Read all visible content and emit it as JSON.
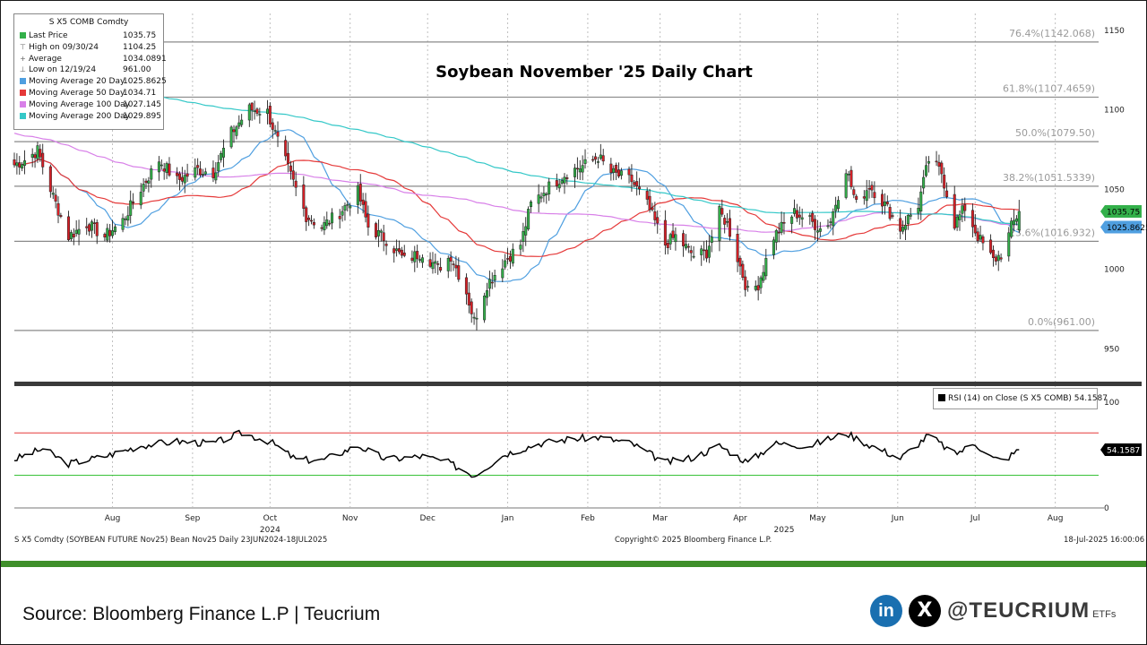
{
  "chart_data": {
    "type": "candlestick",
    "title": "Soybean November '25 Daily Chart",
    "ylim": [
      930,
      1160
    ],
    "yticks": [
      950,
      1000,
      1050,
      1100,
      1150
    ],
    "x_start": "2024-06-24",
    "x_end": "2025-08-15",
    "month_ticks": [
      {
        "label": "Aug",
        "date": "2024-08-01"
      },
      {
        "label": "Sep",
        "date": "2024-09-01"
      },
      {
        "label": "Oct",
        "date": "2024-10-01"
      },
      {
        "label": "Nov",
        "date": "2024-11-01"
      },
      {
        "label": "Dec",
        "date": "2024-12-01"
      },
      {
        "label": "Jan",
        "date": "2025-01-01"
      },
      {
        "label": "Feb",
        "date": "2025-02-01"
      },
      {
        "label": "Mar",
        "date": "2025-03-01"
      },
      {
        "label": "Apr",
        "date": "2025-04-01"
      },
      {
        "label": "May",
        "date": "2025-05-01"
      },
      {
        "label": "Jun",
        "date": "2025-06-01"
      },
      {
        "label": "Jul",
        "date": "2025-07-01"
      },
      {
        "label": "Aug",
        "date": "2025-08-01"
      }
    ],
    "year_labels": [
      {
        "label": "2024",
        "date": "2024-10-01"
      },
      {
        "label": "2025",
        "date": "2025-04-18"
      }
    ],
    "fib_levels": [
      {
        "label": "76.4%(1142.068)",
        "value": 1142.068
      },
      {
        "label": "61.8%(1107.4659)",
        "value": 1107.4659
      },
      {
        "label": "50.0%(1079.50)",
        "value": 1079.5
      },
      {
        "label": "38.2%(1051.5339)",
        "value": 1051.5339
      },
      {
        "label": "23.6%(1016.932)",
        "value": 1016.932
      },
      {
        "label": "0.0%(961.00)",
        "value": 961.0
      }
    ],
    "close_anchors": [
      [
        "2024-06-24",
        1065
      ],
      [
        "2024-06-28",
        1068
      ],
      [
        "2024-07-03",
        1074
      ],
      [
        "2024-07-09",
        1045
      ],
      [
        "2024-07-15",
        1020
      ],
      [
        "2024-07-22",
        1028
      ],
      [
        "2024-07-29",
        1020
      ],
      [
        "2024-08-05",
        1030
      ],
      [
        "2024-08-12",
        1050
      ],
      [
        "2024-08-19",
        1068
      ],
      [
        "2024-08-26",
        1055
      ],
      [
        "2024-09-03",
        1062
      ],
      [
        "2024-09-09",
        1060
      ],
      [
        "2024-09-16",
        1085
      ],
      [
        "2024-09-23",
        1100
      ],
      [
        "2024-09-30",
        1098
      ],
      [
        "2024-10-04",
        1080
      ],
      [
        "2024-10-09",
        1058
      ],
      [
        "2024-10-15",
        1033
      ],
      [
        "2024-10-21",
        1026
      ],
      [
        "2024-10-28",
        1035
      ],
      [
        "2024-11-04",
        1048
      ],
      [
        "2024-11-08",
        1026
      ],
      [
        "2024-11-15",
        1018
      ],
      [
        "2024-11-22",
        1005
      ],
      [
        "2024-11-29",
        1010
      ],
      [
        "2024-12-05",
        1000
      ],
      [
        "2024-12-10",
        1008
      ],
      [
        "2024-12-16",
        985
      ],
      [
        "2024-12-19",
        967
      ],
      [
        "2024-12-24",
        990
      ],
      [
        "2024-12-31",
        1005
      ],
      [
        "2025-01-06",
        1015
      ],
      [
        "2025-01-10",
        1040
      ],
      [
        "2025-01-16",
        1050
      ],
      [
        "2025-01-24",
        1060
      ],
      [
        "2025-01-31",
        1065
      ],
      [
        "2025-02-05",
        1070
      ],
      [
        "2025-02-10",
        1060
      ],
      [
        "2025-02-18",
        1055
      ],
      [
        "2025-02-24",
        1040
      ],
      [
        "2025-03-03",
        1015
      ],
      [
        "2025-03-07",
        1020
      ],
      [
        "2025-03-14",
        1008
      ],
      [
        "2025-03-19",
        1010
      ],
      [
        "2025-03-24",
        1035
      ],
      [
        "2025-03-27",
        1028
      ],
      [
        "2025-04-04",
        985
      ],
      [
        "2025-04-08",
        990
      ],
      [
        "2025-04-14",
        1020
      ],
      [
        "2025-04-22",
        1035
      ],
      [
        "2025-04-28",
        1030
      ],
      [
        "2025-05-02",
        1025
      ],
      [
        "2025-05-06",
        1030
      ],
      [
        "2025-05-12",
        1063
      ],
      [
        "2025-05-16",
        1040
      ],
      [
        "2025-05-21",
        1052
      ],
      [
        "2025-05-27",
        1040
      ],
      [
        "2025-06-02",
        1025
      ],
      [
        "2025-06-09",
        1040
      ],
      [
        "2025-06-13",
        1068
      ],
      [
        "2025-06-18",
        1060
      ],
      [
        "2025-06-23",
        1028
      ],
      [
        "2025-06-27",
        1038
      ],
      [
        "2025-07-02",
        1020
      ],
      [
        "2025-07-08",
        1005
      ],
      [
        "2025-07-12",
        1010
      ],
      [
        "2025-07-15",
        1026
      ],
      [
        "2025-07-18",
        1035.75
      ]
    ],
    "rsi": {
      "label": "RSI (14)  on Close (S X5 COMB) 54.1587",
      "value": 54.1587,
      "ylim": [
        0,
        110
      ],
      "yticks": [
        0,
        100
      ],
      "overbought": 70,
      "oversold": 30,
      "anchors": [
        [
          "2024-06-24",
          45
        ],
        [
          "2024-07-05",
          55
        ],
        [
          "2024-07-15",
          41
        ],
        [
          "2024-07-29",
          48
        ],
        [
          "2024-08-12",
          58
        ],
        [
          "2024-08-26",
          62
        ],
        [
          "2024-09-09",
          60
        ],
        [
          "2024-09-20",
          70
        ],
        [
          "2024-10-01",
          62
        ],
        [
          "2024-10-11",
          45
        ],
        [
          "2024-10-21",
          44
        ],
        [
          "2024-11-04",
          58
        ],
        [
          "2024-11-15",
          45
        ],
        [
          "2024-11-29",
          48
        ],
        [
          "2024-12-09",
          42
        ],
        [
          "2024-12-19",
          30
        ],
        [
          "2024-12-31",
          50
        ],
        [
          "2025-01-13",
          60
        ],
        [
          "2025-01-24",
          64
        ],
        [
          "2025-02-05",
          66
        ],
        [
          "2025-02-18",
          60
        ],
        [
          "2025-03-03",
          42
        ],
        [
          "2025-03-14",
          47
        ],
        [
          "2025-03-24",
          58
        ],
        [
          "2025-04-04",
          42
        ],
        [
          "2025-04-14",
          60
        ],
        [
          "2025-04-28",
          58
        ],
        [
          "2025-05-12",
          70
        ],
        [
          "2025-05-20",
          60
        ],
        [
          "2025-06-02",
          46
        ],
        [
          "2025-06-13",
          68
        ],
        [
          "2025-06-23",
          50
        ],
        [
          "2025-07-01",
          60
        ],
        [
          "2025-07-08",
          46
        ],
        [
          "2025-07-12",
          44
        ],
        [
          "2025-07-18",
          54.16
        ]
      ]
    },
    "series": [
      {
        "name": "Moving Average 20 Day",
        "value": "1025.8625",
        "color": "#4f9fe0",
        "period": 20
      },
      {
        "name": "Moving Average 50 Day",
        "value": "1034.71",
        "color": "#e53939",
        "period": 50
      },
      {
        "name": "Moving Average 100 Day",
        "value": "1027.145",
        "color": "#d880e8",
        "period": 100
      },
      {
        "name": "Moving Average 200 Day",
        "value": "1029.895",
        "color": "#35c8c8",
        "period": 200
      }
    ],
    "price_labels": [
      {
        "text": "1035.75",
        "value": 1035.75,
        "color": "#33b04a"
      },
      {
        "text": "1025.8625",
        "value": 1025.8625,
        "color": "#4f9fe0"
      }
    ],
    "rsi_label": {
      "text": "54.1587",
      "value": 54.1587
    }
  },
  "legend": {
    "title": "S X5 COMB Comdty",
    "rows": [
      {
        "label": "Last Price",
        "value": "1035.75",
        "color": "#33b04a"
      },
      {
        "label": "High on 09/30/24",
        "value": "1104.25",
        "symbol": "⊤"
      },
      {
        "label": "Average",
        "value": "1034.0891",
        "symbol": "+"
      },
      {
        "label": "Low on 12/19/24",
        "value": "961.00",
        "symbol": "⊥"
      },
      {
        "label": "Moving Average 20 Day",
        "value": "1025.8625",
        "color": "#4f9fe0"
      },
      {
        "label": "Moving Average 50 Day",
        "value": "1034.71",
        "color": "#e53939"
      },
      {
        "label": "Moving Average 100 Day",
        "value": "1027.145",
        "color": "#d880e8"
      },
      {
        "label": "Moving Average 200 Day",
        "value": "1029.895",
        "color": "#35c8c8"
      }
    ]
  },
  "footer": {
    "left": "S X5 Comdty (SOYBEAN FUTURE    Nov25) Bean Nov25  Daily 23JUN2024-18JUL2025",
    "center": "Copyright© 2025 Bloomberg Finance L.P.",
    "right": "18-Jul-2025 16:00:06"
  },
  "source": "Source: Bloomberg Finance L.P | Teucrium",
  "social": {
    "linkedin": "in",
    "x": "X",
    "handle": "@TEUCRIUM",
    "suffix": "ETFs"
  }
}
